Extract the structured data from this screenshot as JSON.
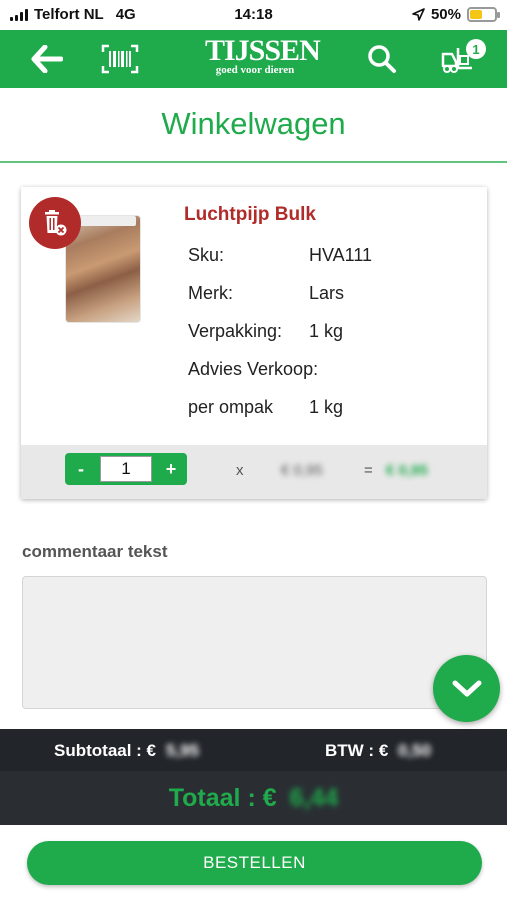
{
  "status_bar": {
    "carrier": "Telfort NL",
    "network": "4G",
    "time": "14:18",
    "battery": "50%",
    "battery_level": 0.5
  },
  "nav": {
    "logo_brand": "TIJSSEN",
    "logo_tagline": "goed voor dieren",
    "cart_count": "1",
    "icons": [
      "back-arrow-icon",
      "barcode-scan-icon",
      "search-icon",
      "forklift-cart-icon"
    ]
  },
  "page": {
    "title": "Winkelwagen"
  },
  "product": {
    "name": "Luchtpijp Bulk",
    "specs": [
      {
        "label": "Sku:",
        "value": "HVA111"
      },
      {
        "label": "Merk:",
        "value": "Lars"
      },
      {
        "label": "Verpakking:",
        "value": "1 kg"
      },
      {
        "label": "Advies Verkoop:",
        "value": ""
      },
      {
        "label": "per ompak",
        "value": "1 kg"
      }
    ],
    "quantity": "1",
    "minus_label": "-",
    "plus_label": "+",
    "times": "x",
    "price": "€ 0,95",
    "equals": "=",
    "line_total": "€ 0,95"
  },
  "comment": {
    "label": "commentaar tekst",
    "value": ""
  },
  "totals": {
    "subtotal_label": "Subtotaal : €",
    "subtotal_value": "5,95",
    "btw_label": "BTW : €",
    "btw_value": "0,50",
    "total_label": "Totaal : €",
    "total_value": "6,44"
  },
  "actions": {
    "order_label": "BESTELLEN"
  },
  "colors": {
    "primary_green": "#1faa4b",
    "product_red": "#b22b2b",
    "dark_footer": "#22262b"
  }
}
